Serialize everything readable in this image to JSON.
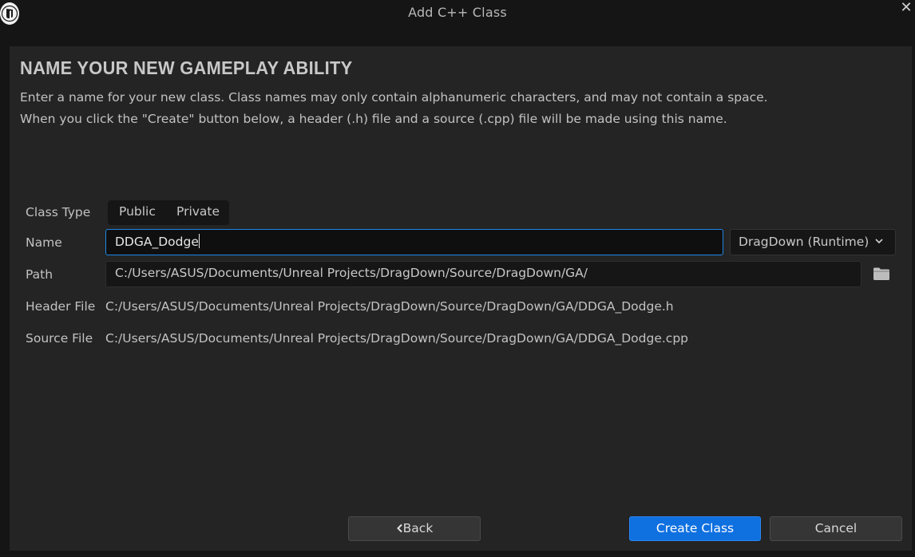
{
  "window": {
    "title": "Add C++ Class",
    "close_glyph": "✕"
  },
  "header": {
    "title": "NAME YOUR NEW GAMEPLAY ABILITY",
    "desc_line1": "Enter a name for your new class. Class names may only contain alphanumeric characters, and may not contain a space.",
    "desc_line2": "When you click the \"Create\" button below, a header (.h) file and a source (.cpp) file will be made using this name."
  },
  "form": {
    "class_type_label": "Class Type",
    "class_type_options": [
      "Public",
      "Private"
    ],
    "name_label": "Name",
    "name_value": "DDGA_Dodge",
    "module_value": "DragDown (Runtime)",
    "path_label": "Path",
    "path_value": "C:/Users/ASUS/Documents/Unreal Projects/DragDown/Source/DragDown/GA/",
    "header_file_label": "Header File",
    "header_file_value": "C:/Users/ASUS/Documents/Unreal Projects/DragDown/Source/DragDown/GA/DDGA_Dodge.h",
    "source_file_label": "Source File",
    "source_file_value": "C:/Users/ASUS/Documents/Unreal Projects/DragDown/Source/DragDown/GA/DDGA_Dodge.cpp"
  },
  "buttons": {
    "back_label": "Back",
    "create_label": "Create Class",
    "cancel_label": "Cancel"
  },
  "icons": {
    "app": "unreal-engine-logo-icon",
    "close": "close-icon",
    "module_dropdown": "chevron-down-icon",
    "browse": "folder-icon",
    "back": "chevron-left-icon"
  },
  "colors": {
    "accent": "#0f70e0",
    "focus_border": "#1f86e6",
    "panel": "#242424",
    "background": "#151515"
  }
}
